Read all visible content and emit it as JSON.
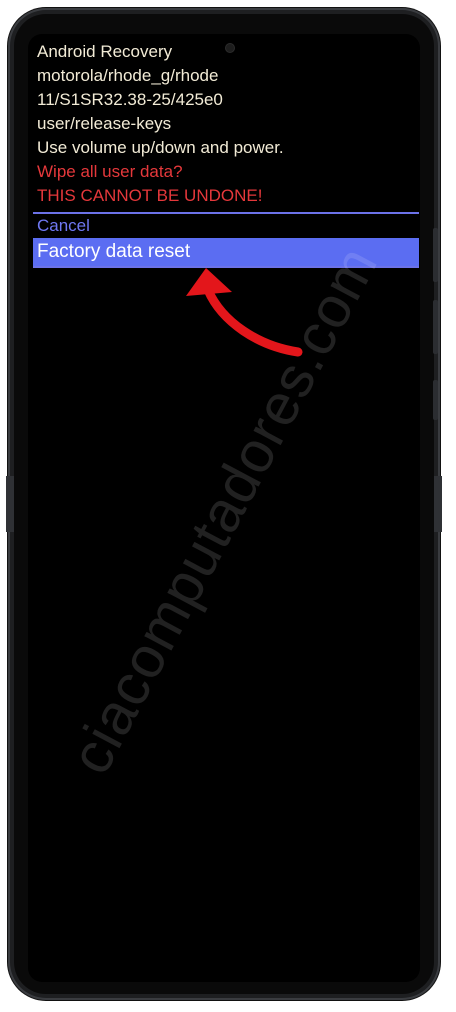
{
  "recovery": {
    "lines": [
      "Android Recovery",
      "motorola/rhode_g/rhode",
      "11/S1SR32.38-25/425e0",
      "user/release-keys",
      "Use volume up/down and power."
    ],
    "warning_lines": [
      "Wipe all user data?",
      "THIS CANNOT BE UNDONE!"
    ]
  },
  "menu": {
    "items": [
      {
        "label": "Cancel",
        "selected": false
      },
      {
        "label": "Factory data reset",
        "selected": true
      }
    ]
  },
  "watermark": {
    "text": "ciacomputadores.com"
  },
  "colors": {
    "info_text": "#f2ebd6",
    "warning_text": "#e5383b",
    "menu_text": "#6f78f2",
    "selected_bg": "#5b6df2",
    "arrow": "#e3161b"
  },
  "icons": {
    "annotation": "curved-red-arrow-icon"
  }
}
